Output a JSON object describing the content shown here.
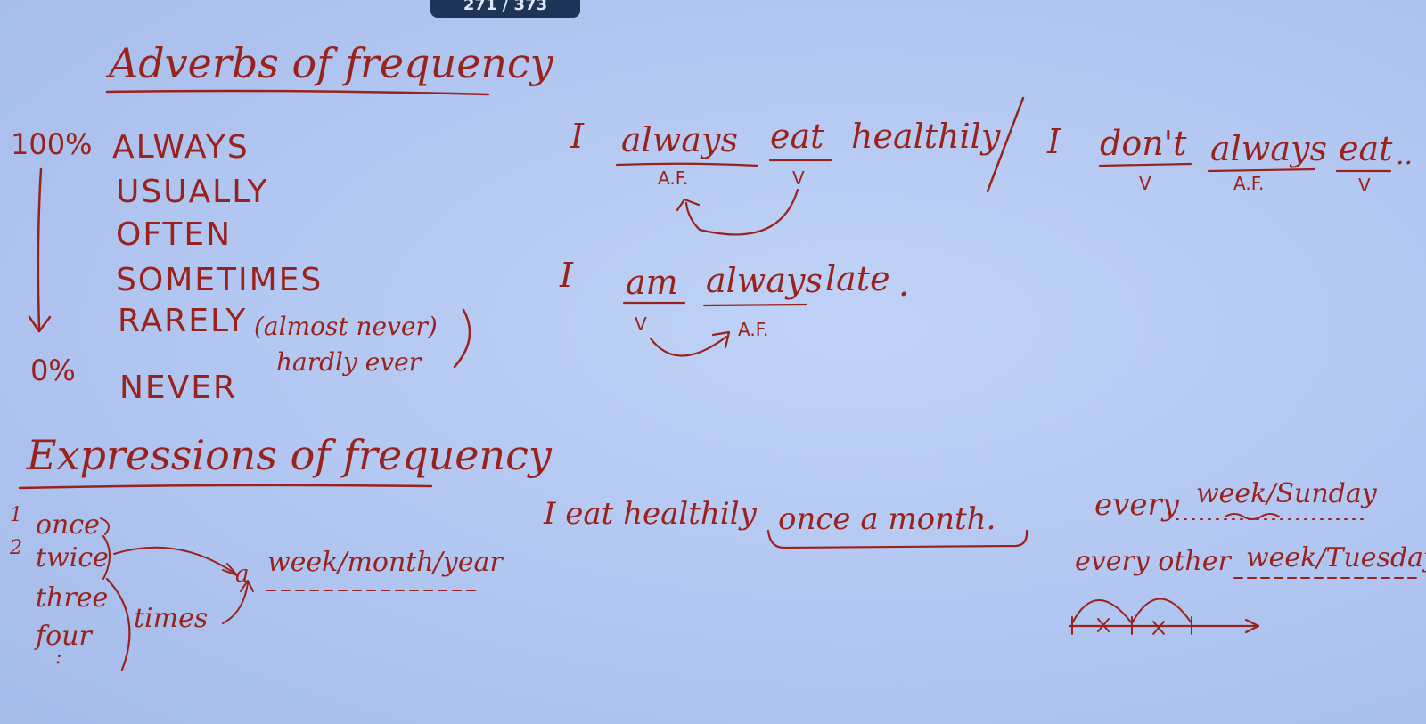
{
  "overlay": {
    "counter": "271 / 373"
  },
  "adverbs": {
    "heading": "Adverbs of frequency",
    "pct_top": "100%",
    "pct_bottom": "0%",
    "list": [
      "ALWAYS",
      "USUALLY",
      "OFTEN",
      "SOMETIMES",
      "RARELY",
      "NEVER"
    ],
    "rarely_note": "(almost never)",
    "rarely_note2": "hardly ever"
  },
  "expressions": {
    "heading": "Expressions of frequency",
    "numbers": [
      "1",
      "2"
    ],
    "counts": [
      "once",
      "twice",
      "three",
      "four"
    ],
    "times": "times",
    "a": "a",
    "period": "week/month/year",
    "dots": ":"
  },
  "examples": {
    "ex1": {
      "pronoun": "I",
      "adverb": "always",
      "verb": "eat",
      "rest": "healthily",
      "adverb_tag": "A.F.",
      "verb_tag": "V"
    },
    "ex2": {
      "pronoun": "I",
      "aux": "don't",
      "adverb": "always",
      "verb": "eat",
      "trail": "..",
      "aux_tag": "V",
      "adverb_tag": "A.F.",
      "verb_tag": "V"
    },
    "ex3": {
      "pronoun": "I",
      "verb": "am",
      "adverb": "always",
      "rest": "late",
      "dot": ".",
      "verb_tag": "V",
      "adverb_tag": "A.F."
    },
    "ex4": {
      "sentence": "I eat healthily",
      "phrase": "once a month."
    },
    "every": {
      "every": "every",
      "every_value": "week/Sunday",
      "every_other": "every other",
      "every_other_value": "week/Tuesday"
    }
  }
}
